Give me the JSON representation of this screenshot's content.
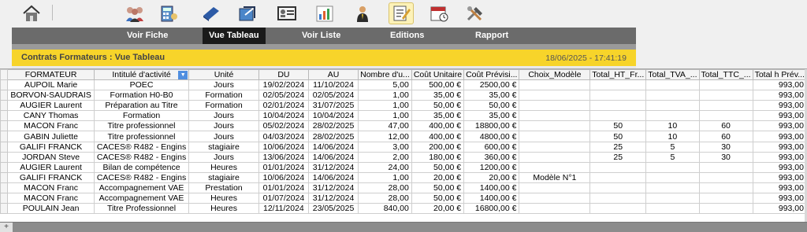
{
  "toolbar": {
    "icons": [
      "home-icon",
      "users-icon",
      "calculator-icon",
      "book-icon",
      "export-icon",
      "id-card-icon",
      "bar-chart-icon",
      "person-icon",
      "edit-icon",
      "calendar-icon",
      "tools-icon"
    ]
  },
  "nav": {
    "items": [
      "Voir Fiche",
      "Vue Tableau",
      "Voir Liste",
      "Editions",
      "Rapport"
    ],
    "active": "Vue Tableau"
  },
  "header": {
    "title": "Contrats Formateurs : Vue Tableau",
    "datetime": "18/06/2025  -  17:41:19"
  },
  "table": {
    "columns": [
      "FORMATEUR",
      "Intitulé d'activité",
      "Unité",
      "DU",
      "AU",
      "Nombre d'u...",
      "Coût Unitaire",
      "Coût Prévisi...",
      "Choix_Modèle",
      "Total_HT_Fr...",
      "Total_TVA_...",
      "Total_TTC_...",
      "Total h Prév..."
    ],
    "rows": [
      [
        "AUPOIL Marie",
        "POEC",
        "Jours",
        "19/02/2024",
        "11/10/2024",
        "5,00",
        "500,00 €",
        "2500,00 €",
        "",
        "",
        "",
        "",
        "993,00"
      ],
      [
        "BORVON-SAUDRAIS",
        "Formation H0-B0",
        "Formation",
        "02/05/2024",
        "02/05/2024",
        "1,00",
        "35,00 €",
        "35,00 €",
        "",
        "",
        "",
        "",
        "993,00"
      ],
      [
        "AUGIER Laurent",
        "Préparation au Titre",
        "Formation",
        "02/01/2024",
        "31/07/2025",
        "1,00",
        "50,00 €",
        "50,00 €",
        "",
        "",
        "",
        "",
        "993,00"
      ],
      [
        "CANY Thomas",
        "Formation",
        "Jours",
        "10/04/2024",
        "10/04/2024",
        "1,00",
        "35,00 €",
        "35,00 €",
        "",
        "",
        "",
        "",
        "993,00"
      ],
      [
        "MACON Franc",
        "Titre professionnel",
        "Jours",
        "05/02/2024",
        "28/02/2025",
        "47,00",
        "400,00 €",
        "18800,00 €",
        "",
        "50",
        "10",
        "60",
        "993,00"
      ],
      [
        "GABIN Juliette",
        "Titre professionnel",
        "Jours",
        "04/03/2024",
        "28/02/2025",
        "12,00",
        "400,00 €",
        "4800,00 €",
        "",
        "50",
        "10",
        "60",
        "993,00"
      ],
      [
        "GALIFI FRANCK",
        "CACES® R482 - Engins",
        "stagiaire",
        "10/06/2024",
        "14/06/2024",
        "3,00",
        "200,00 €",
        "600,00 €",
        "",
        "25",
        "5",
        "30",
        "993,00"
      ],
      [
        "JORDAN Steve",
        "CACES® R482 - Engins",
        "Jours",
        "13/06/2024",
        "14/06/2024",
        "2,00",
        "180,00 €",
        "360,00 €",
        "",
        "25",
        "5",
        "30",
        "993,00"
      ],
      [
        "AUGIER Laurent",
        "Bilan de compétence",
        "Heures",
        "01/01/2024",
        "31/12/2024",
        "24,00",
        "50,00 €",
        "1200,00 €",
        "",
        "",
        "",
        "",
        "993,00"
      ],
      [
        "GALIFI FRANCK",
        "CACES® R482 - Engins",
        "stagiaire",
        "10/06/2024",
        "14/06/2024",
        "1,00",
        "20,00 €",
        "20,00 €",
        "Modèle N°1",
        "",
        "",
        "",
        "993,00"
      ],
      [
        "MACON Franc",
        "Accompagnement VAE",
        "Prestation",
        "01/01/2024",
        "31/12/2024",
        "28,00",
        "50,00 €",
        "1400,00 €",
        "",
        "",
        "",
        "",
        "993,00"
      ],
      [
        "MACON Franc",
        "Accompagnement VAE",
        "Heures",
        "01/07/2024",
        "31/12/2024",
        "28,00",
        "50,00 €",
        "1400,00 €",
        "",
        "",
        "",
        "",
        "993,00"
      ],
      [
        "POULAIN Jean",
        "Titre Professionnel",
        "Heures",
        "12/11/2024",
        "23/05/2025",
        "840,00",
        "20,00 €",
        "16800,00 €",
        "",
        "",
        "",
        "",
        "993,00"
      ]
    ]
  },
  "colors": {
    "accent": "#f7d42a",
    "nav": "#6b6b6b",
    "nav_active": "#1a1a1a",
    "sort": "#4f8ee0"
  }
}
